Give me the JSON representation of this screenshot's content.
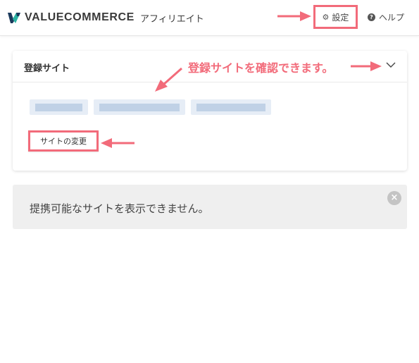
{
  "header": {
    "brand": "VALUECOMMERCE",
    "brand_sub": "アフィリエイト",
    "settings_label": "設定",
    "help_label": "ヘルプ"
  },
  "sites_card": {
    "title": "登録サイト",
    "change_button_label": "サイトの変更"
  },
  "notice": {
    "message": "提携可能なサイトを表示できません。"
  },
  "annotation": {
    "callout_text": "登録サイトを確認できます。"
  },
  "colors": {
    "highlight": "#f26b7a",
    "logo_dark": "#1b3a5c",
    "logo_teal": "#2bb3a3",
    "notice_bg": "#efefef",
    "chip_bg": "#e6edf6"
  },
  "icons": {
    "settings": "gear-icon",
    "help": "question-circle-icon",
    "toggle": "chevron-down-icon",
    "dismiss": "close-icon"
  }
}
